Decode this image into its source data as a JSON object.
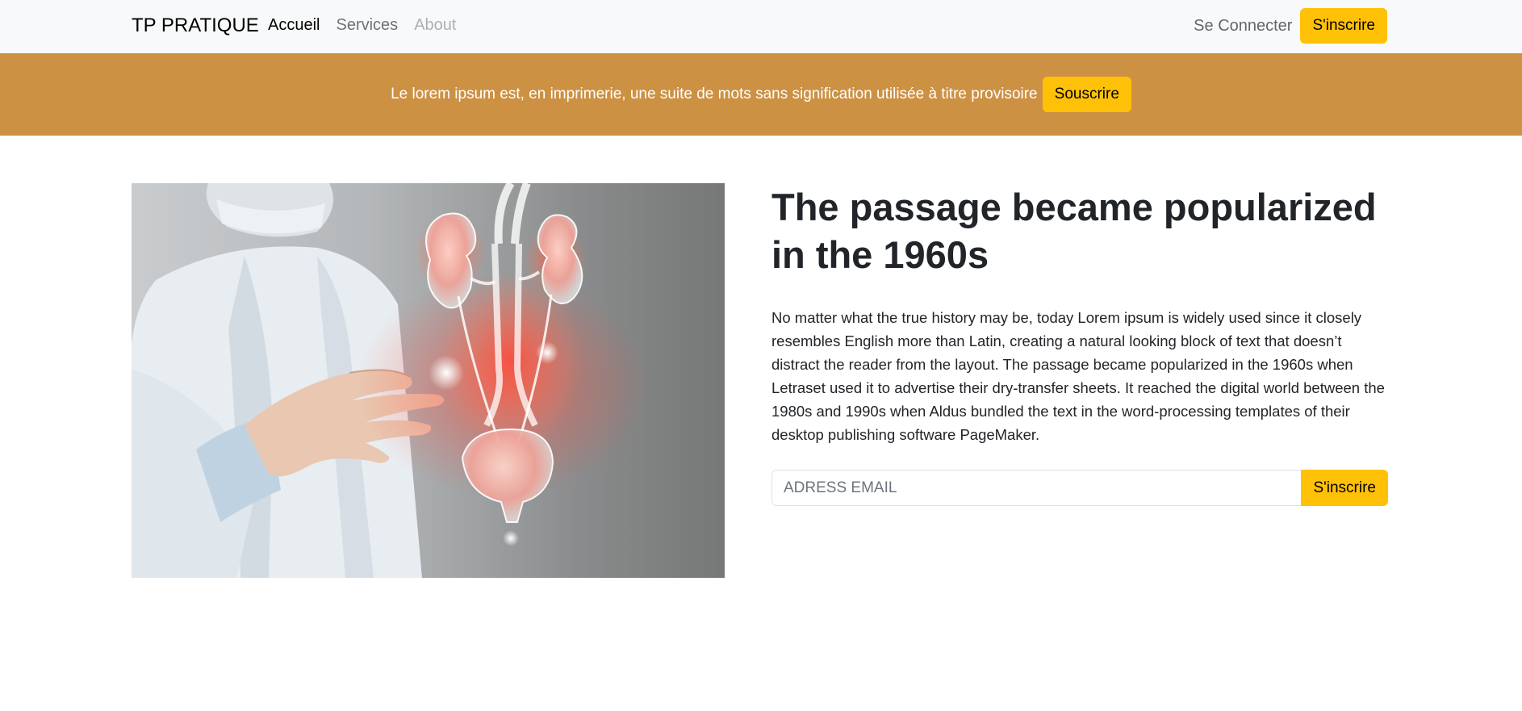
{
  "navbar": {
    "brand": "TP PRATIQUE",
    "links": [
      {
        "label": "Accueil",
        "state": "active"
      },
      {
        "label": "Services",
        "state": "normal"
      },
      {
        "label": "About",
        "state": "disabled"
      }
    ],
    "login_label": "Se Connecter",
    "signup_label": "S'inscrire"
  },
  "banner": {
    "text": "Le lorem ipsum est, en imprimerie, une suite de mots sans signification utilisée à titre provisoire",
    "button_label": "Souscrire",
    "background_color": "#cc9143"
  },
  "hero": {
    "image_subject": "doctor-holding-glowing-kidneys-urinary-system-illustration",
    "title": "The passage became popularized in the 1960s",
    "paragraph": "No matter what the true history may be, today Lorem ipsum is widely used since it closely resembles English more than Latin, creating a natural looking block of text that doesn’t distract the reader from the layout. The passage became popularized in the 1960s when Letraset used it to advertise their dry-transfer sheets. It reached the digital world between the 1980s and 1990s when Aldus bundled the text in the word-processing templates of their desktop publishing software PageMaker.",
    "email_placeholder": "ADRESS EMAIL",
    "email_value": "",
    "submit_label": "S'inscrire"
  },
  "colors": {
    "accent": "#ffc107",
    "navbar_bg": "#f8f9fa",
    "text": "#212529"
  }
}
